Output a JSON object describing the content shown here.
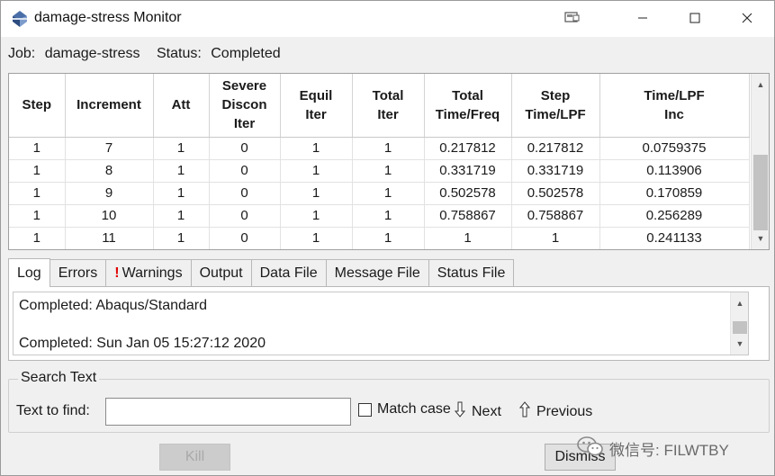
{
  "window": {
    "title": "damage-stress Monitor",
    "app_icon": "abaqus-icon",
    "controls": [
      "restore-window-icon",
      "minimize-icon",
      "maximize-icon",
      "close-icon"
    ]
  },
  "job": {
    "job_label": "Job:",
    "job_value": "damage-stress",
    "status_label": "Status:",
    "status_value": "Completed"
  },
  "table": {
    "headers": [
      [
        "Step"
      ],
      [
        "Increment"
      ],
      [
        "Att"
      ],
      [
        "Severe",
        "Discon",
        "Iter"
      ],
      [
        "Equil",
        "Iter"
      ],
      [
        "Total",
        "Iter"
      ],
      [
        "Total",
        "Time/Freq"
      ],
      [
        "Step",
        "Time/LPF"
      ],
      [
        "Time/LPF",
        "Inc"
      ]
    ],
    "rows": [
      [
        "1",
        "7",
        "1",
        "0",
        "1",
        "1",
        "0.217812",
        "0.217812",
        "0.0759375"
      ],
      [
        "1",
        "8",
        "1",
        "0",
        "1",
        "1",
        "0.331719",
        "0.331719",
        "0.113906"
      ],
      [
        "1",
        "9",
        "1",
        "0",
        "1",
        "1",
        "0.502578",
        "0.502578",
        "0.170859"
      ],
      [
        "1",
        "10",
        "1",
        "0",
        "1",
        "1",
        "0.758867",
        "0.758867",
        "0.256289"
      ],
      [
        "1",
        "11",
        "1",
        "0",
        "1",
        "1",
        "1",
        "1",
        "0.241133"
      ]
    ]
  },
  "tabs": [
    {
      "label": "Log",
      "active": true
    },
    {
      "label": "Errors"
    },
    {
      "label": "Warnings",
      "warning_mark": "!"
    },
    {
      "label": "Output"
    },
    {
      "label": "Data File"
    },
    {
      "label": "Message File"
    },
    {
      "label": "Status File"
    }
  ],
  "log": {
    "lines": [
      "Completed: Abaqus/Standard",
      "",
      "Completed: Sun Jan 05 15:27:12 2020"
    ]
  },
  "search": {
    "group_title": "Search Text",
    "find_label": "Text to find:",
    "find_value": "",
    "match_case_label": "Match case",
    "match_case_checked": false,
    "next_label": "Next",
    "previous_label": "Previous"
  },
  "buttons": {
    "kill_label": "Kill",
    "kill_enabled": false,
    "dismiss_label": "Dismiss"
  },
  "watermark": {
    "text": "微信号: FILWTBY",
    "icon": "wechat-icon"
  }
}
